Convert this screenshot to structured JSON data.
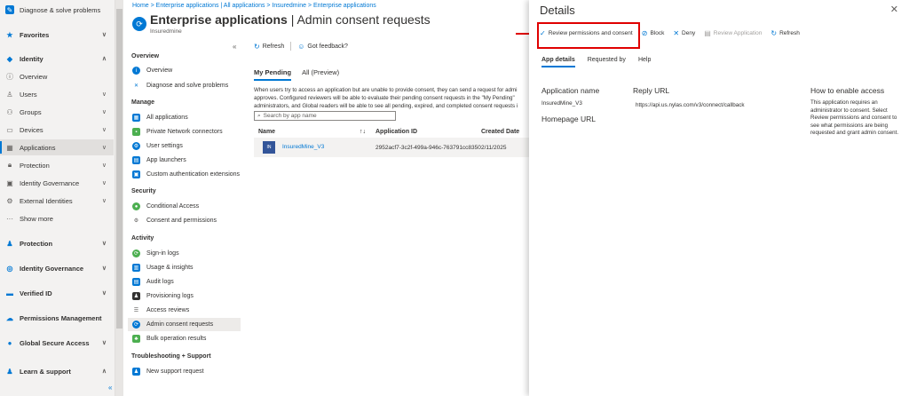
{
  "left_nav": {
    "items": [
      {
        "label": "Diagnose & solve problems",
        "icon": "wrench-icon",
        "chevron": ""
      },
      {
        "label": "Favorites",
        "icon": "star-icon",
        "chevron": "∨"
      },
      {
        "label": "Identity",
        "icon": "identity-icon",
        "chevron": "∧"
      },
      {
        "label": "Overview",
        "icon": "info-icon",
        "chevron": ""
      },
      {
        "label": "Users",
        "icon": "person-icon",
        "chevron": "∨"
      },
      {
        "label": "Groups",
        "icon": "group-icon",
        "chevron": "∨"
      },
      {
        "label": "Devices",
        "icon": "devices-icon",
        "chevron": "∨"
      },
      {
        "label": "Applications",
        "icon": "applications-icon",
        "chevron": "∨"
      },
      {
        "label": "Protection",
        "icon": "lock-icon",
        "chevron": "∨"
      },
      {
        "label": "Identity Governance",
        "icon": "governance-icon",
        "chevron": "∨"
      },
      {
        "label": "External Identities",
        "icon": "external-icon",
        "chevron": "∨"
      },
      {
        "label": "Show more",
        "icon": "more-icon",
        "chevron": ""
      },
      {
        "label": "Protection",
        "icon": "protection-icon",
        "chevron": "∨"
      },
      {
        "label": "Identity Governance",
        "icon": "governance-icon",
        "chevron": "∨"
      },
      {
        "label": "Verified ID",
        "icon": "verified-id-icon",
        "chevron": "∨"
      },
      {
        "label": "Permissions Management",
        "icon": "permissions-icon",
        "chevron": ""
      },
      {
        "label": "Global Secure Access",
        "icon": "globe-icon",
        "chevron": "∨"
      },
      {
        "label": "Learn & support",
        "icon": "support-icon",
        "chevron": "∧"
      }
    ],
    "collapse_glyph": "«"
  },
  "breadcrumb": "Home > Enterprise applications | All applications > Insuredmine > Enterprise applications",
  "page": {
    "title_bold": "Enterprise applications",
    "title_rest": " | Admin consent requests",
    "subtitle": "Insuredmine",
    "more": "···",
    "collapse": "«"
  },
  "side_menu": {
    "overview_header": "Overview",
    "manage_header": "Manage",
    "security_header": "Security",
    "activity_header": "Activity",
    "troubleshooting_header": "Troubleshooting + Support",
    "items": {
      "overview": "Overview",
      "diagnose": "Diagnose and solve problems",
      "all_apps": "All applications",
      "private_network": "Private Network connectors",
      "user_settings": "User settings",
      "app_launchers": "App launchers",
      "custom_auth": "Custom authentication extensions",
      "conditional_access": "Conditional Access",
      "consent_permissions": "Consent and permissions",
      "signin_logs": "Sign-in logs",
      "usage_insights": "Usage & insights",
      "audit_logs": "Audit logs",
      "provisioning_logs": "Provisioning logs",
      "access_reviews": "Access reviews",
      "admin_consent": "Admin consent requests",
      "bulk_ops": "Bulk operation results",
      "new_support": "New support request"
    }
  },
  "toolbar": {
    "refresh": "Refresh",
    "feedback": "Got feedback?"
  },
  "tabs": {
    "my_pending": "My Pending",
    "all_preview": "All (Preview)"
  },
  "description": {
    "line1": "When users try to access an application but are unable to provide consent, they can send a request for admi",
    "line2": "approves. Configured reviewers will be able to evaluate their pending consent requests in the \"My Pending\"",
    "line3": "administrators, and Global readers will be able to see all pending, expired, and completed consent requests i"
  },
  "search": {
    "placeholder": "Search by app name"
  },
  "table": {
    "headers": {
      "name": "Name",
      "app_id": "Application ID",
      "created": "Created Date",
      "sort": "↑↓"
    },
    "rows": [
      {
        "initials": "IN",
        "name": "InsuredMine_V3",
        "app_id": "2952acf7-3c2f-499a-946c-763791cc8350",
        "created": "2/11/2025"
      }
    ]
  },
  "details": {
    "title": "Details",
    "close": "✕",
    "toolbar": {
      "review": "Review permissions and consent",
      "block": "Block",
      "deny": "Deny",
      "review_app": "Review Application",
      "refresh": "Refresh"
    },
    "tabs": {
      "app_details": "App details",
      "requested_by": "Requested by",
      "help": "Help"
    },
    "application_name_label": "Application name",
    "application_name_value": "InsuredMine_V3",
    "reply_url_label": "Reply URL",
    "reply_url_value": "https://api.us.nylas.com/v3/connect/callback",
    "homepage_url_label": "Homepage URL",
    "how_to_enable_label": "How to enable access",
    "how_to_enable_text": "This application requires an administrator to consent. Select Review permissions and consent to see what permissions are being requested and grant admin consent."
  },
  "colors": {
    "accent": "#0078d4",
    "highlight": "#e00000"
  }
}
